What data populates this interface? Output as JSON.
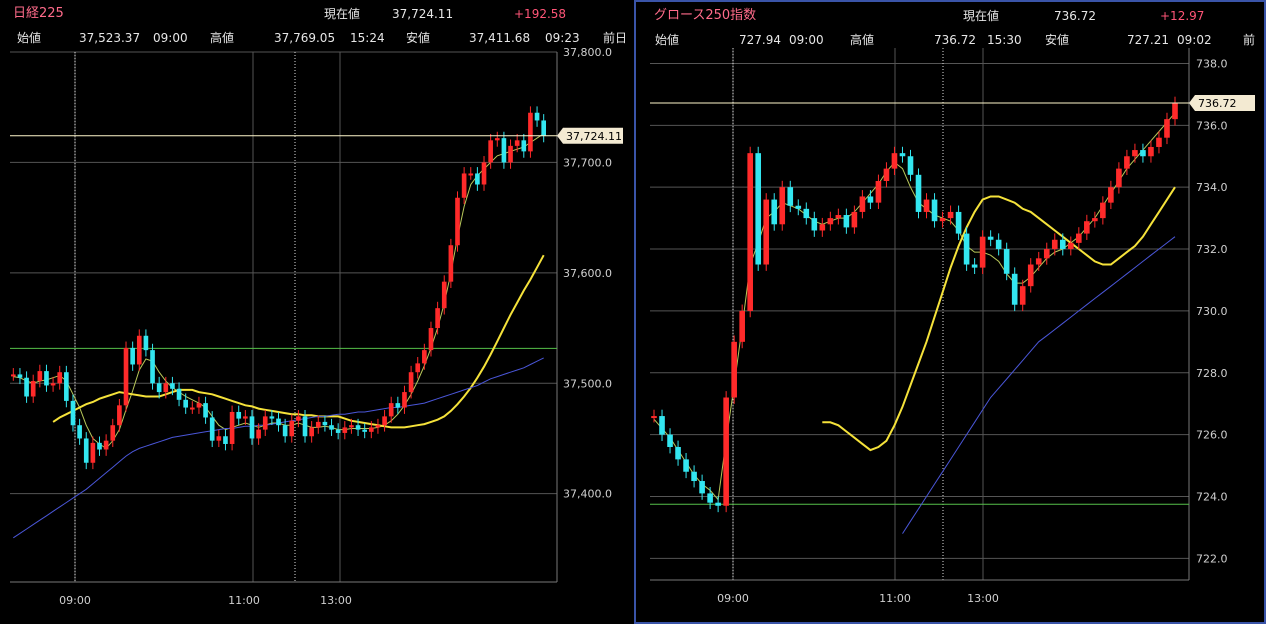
{
  "colors": {
    "up": "#ff2a2a",
    "down": "#33e6f0",
    "grid": "#555",
    "ma_short": "#b8c85a",
    "ma_mid": "#f5e23a",
    "ma_long": "#4a56d8",
    "price_line": "#fff7cc",
    "ref_line": "#56c04a"
  },
  "charts": [
    {
      "name": "日経225",
      "header": {
        "current_label": "現在値",
        "current_value": "37,724.11",
        "change": "+192.58",
        "open_label": "始値",
        "open_value": "37,523.37",
        "open_time": "09:00",
        "high_label": "高値",
        "high_value": "37,769.05",
        "high_time": "15:24",
        "low_label": "安値",
        "low_value": "37,411.68",
        "low_time": "09:23",
        "prev_label": "前日"
      },
      "price_label": "37,724.11",
      "y_ticks": [
        "37,800.0",
        "37,700.0",
        "37,600.0",
        "37,500.0",
        "37,400.0"
      ],
      "x_ticks": [
        "09:00",
        "11:00",
        "13:00"
      ]
    },
    {
      "name": "グロース250指数",
      "header": {
        "current_label": "現在値",
        "current_value": "736.72",
        "change": "+12.97",
        "open_label": "始値",
        "open_value": "727.94",
        "open_time": "09:00",
        "high_label": "高値",
        "high_value": "736.72",
        "high_time": "15:30",
        "low_label": "安値",
        "low_value": "727.21",
        "low_time": "09:02",
        "prev_label": "前"
      },
      "price_label": "736.72",
      "y_ticks": [
        "738.0",
        "736.0",
        "734.0",
        "732.0",
        "730.0",
        "728.0",
        "726.0",
        "724.0",
        "722.0"
      ],
      "x_ticks": [
        "09:00",
        "11:00",
        "13:00"
      ]
    }
  ],
  "chart_data": [
    {
      "type": "candlestick",
      "title": "日経225",
      "ylim": [
        37320,
        37800
      ],
      "y_ticks": [
        37800,
        37700,
        37600,
        37500,
        37400
      ],
      "x_ticks": [
        "09:00",
        "11:00",
        "13:00"
      ],
      "current_price": 37724.11,
      "reference_price": 37531.53,
      "series": [
        {
          "name": "close",
          "values": [
            37508,
            37505,
            37488,
            37502,
            37511,
            37498,
            37500,
            37510,
            37484,
            37462,
            37450,
            37428,
            37446,
            37440,
            37448,
            37462,
            37480,
            37532,
            37517,
            37543,
            37530,
            37500,
            37492,
            37500,
            37495,
            37485,
            37478,
            37478,
            37482,
            37469,
            37448,
            37452,
            37445,
            37474,
            37468,
            37470,
            37450,
            37458,
            37470,
            37468,
            37462,
            37452,
            37466,
            37470,
            37452,
            37460,
            37465,
            37462,
            37458,
            37455,
            37460,
            37462,
            37458,
            37456,
            37460,
            37462,
            37470,
            37482,
            37478,
            37492,
            37510,
            37518,
            37530,
            37550,
            37568,
            37592,
            37625,
            37668,
            37690,
            37690,
            37680,
            37700,
            37720,
            37722,
            37700,
            37715,
            37720,
            37710,
            37745,
            37738,
            37724
          ]
        },
        {
          "name": "MA short",
          "values": [
            37506,
            37505,
            37502,
            37500,
            37502,
            37503,
            37505,
            37507,
            37502,
            37490,
            37478,
            37462,
            37450,
            37445,
            37441,
            37448,
            37458,
            37476,
            37493,
            37512,
            37522,
            37520,
            37510,
            37502,
            37496,
            37492,
            37488,
            37485,
            37482,
            37478,
            37470,
            37462,
            37458,
            37460,
            37462,
            37464,
            37462,
            37460,
            37462,
            37464,
            37464,
            37462,
            37462,
            37464,
            37462,
            37460,
            37460,
            37461,
            37460,
            37458,
            37458,
            37459,
            37459,
            37459,
            37459,
            37460,
            37462,
            37466,
            37472,
            37480,
            37490,
            37502,
            37516,
            37532,
            37550,
            37572,
            37600,
            37632,
            37660,
            37680,
            37688,
            37694,
            37700,
            37706,
            37708,
            37710,
            37712,
            37714,
            37718,
            37722,
            37726
          ]
        },
        {
          "name": "MA mid",
          "values": [
            37465,
            37469,
            37472,
            37475,
            37478,
            37481,
            37483,
            37486,
            37488,
            37490,
            37492,
            37491,
            37490,
            37489,
            37488,
            37488,
            37488,
            37490,
            37492,
            37494,
            37494,
            37494,
            37492,
            37491,
            37490,
            37488,
            37486,
            37484,
            37482,
            37480,
            37479,
            37477,
            37476,
            37475,
            37474,
            37473,
            37472,
            37472,
            37471,
            37471,
            37470,
            37470,
            37470,
            37470,
            37468,
            37466,
            37465,
            37464,
            37463,
            37462,
            37461,
            37460,
            37460,
            37460,
            37461,
            37462,
            37463,
            37465,
            37467,
            37470,
            37475,
            37481,
            37488,
            37496,
            37505,
            37515,
            37526,
            37538,
            37550,
            37562,
            37573,
            37584,
            37594,
            37605,
            37616
          ]
        },
        {
          "name": "MA long",
          "values": [
            37360,
            37364,
            37368,
            37372,
            37376,
            37380,
            37384,
            37388,
            37392,
            37396,
            37400,
            37404,
            37409,
            37414,
            37419,
            37424,
            37429,
            37434,
            37438,
            37441,
            37443,
            37445,
            37447,
            37449,
            37451,
            37452,
            37453,
            37454,
            37455,
            37456,
            37457,
            37458,
            37459,
            37459,
            37460,
            37461,
            37461,
            37462,
            37462,
            37463,
            37464,
            37465,
            37466,
            37467,
            37468,
            37469,
            37470,
            37470,
            37471,
            37472,
            37472,
            37473,
            37474,
            37474,
            37475,
            37476,
            37477,
            37478,
            37478,
            37479,
            37480,
            37481,
            37482,
            37484,
            37486,
            37488,
            37490,
            37492,
            37494,
            37496,
            37498,
            37501,
            37504,
            37506,
            37508,
            37510,
            37512,
            37514,
            37517,
            37520,
            37523
          ]
        }
      ]
    },
    {
      "type": "candlestick",
      "title": "グロース250指数",
      "ylim": [
        721.3,
        738.5
      ],
      "y_ticks": [
        738,
        736,
        734,
        732,
        730,
        728,
        726,
        724,
        722
      ],
      "x_ticks": [
        "09:00",
        "11:00",
        "13:00"
      ],
      "current_price": 736.72,
      "reference_price": 723.75,
      "series": [
        {
          "name": "close",
          "values": [
            726.6,
            726.0,
            725.6,
            725.2,
            724.8,
            724.5,
            724.1,
            723.8,
            723.7,
            727.2,
            729.0,
            730.0,
            735.1,
            731.5,
            733.6,
            732.8,
            734.0,
            733.4,
            733.3,
            733.0,
            732.6,
            732.8,
            733.0,
            733.1,
            732.7,
            733.2,
            733.7,
            733.5,
            734.2,
            734.6,
            735.1,
            735.0,
            734.4,
            733.2,
            733.6,
            732.9,
            733.0,
            733.2,
            732.5,
            731.5,
            731.4,
            732.4,
            732.3,
            732.0,
            731.2,
            730.2,
            730.8,
            731.5,
            731.7,
            732.0,
            732.3,
            732.0,
            732.2,
            732.5,
            732.9,
            733.0,
            733.5,
            734.0,
            734.6,
            735.0,
            735.2,
            735.0,
            735.3,
            735.6,
            736.2,
            736.72
          ]
        },
        {
          "name": "MA short",
          "values": [
            726.5,
            726.2,
            725.9,
            725.5,
            725.1,
            724.7,
            724.4,
            724.2,
            723.9,
            725.8,
            727.6,
            729.5,
            731.5,
            732.2,
            733.0,
            733.2,
            733.5,
            733.4,
            733.3,
            733.1,
            732.9,
            732.8,
            732.9,
            733.0,
            733.0,
            733.2,
            733.5,
            733.8,
            734.1,
            734.5,
            734.8,
            734.6,
            734.0,
            733.5,
            733.3,
            733.1,
            733.0,
            732.9,
            732.6,
            732.1,
            731.9,
            731.9,
            731.8,
            731.6,
            731.2,
            730.9,
            730.9,
            731.1,
            731.4,
            731.7,
            731.9,
            732.0,
            732.2,
            732.4,
            732.7,
            733.0,
            733.4,
            733.8,
            734.2,
            734.6,
            734.9,
            735.2,
            735.5,
            735.8,
            736.1,
            736.4
          ]
        },
        {
          "name": "MA mid",
          "values": [
            726.4,
            726.4,
            726.3,
            726.1,
            725.9,
            725.7,
            725.5,
            725.6,
            725.8,
            726.3,
            726.9,
            727.6,
            728.3,
            729.0,
            729.8,
            730.6,
            731.4,
            732.1,
            732.7,
            733.2,
            733.6,
            733.7,
            733.7,
            733.6,
            733.5,
            733.3,
            733.2,
            733.0,
            732.8,
            732.6,
            732.4,
            732.2,
            732.0,
            731.8,
            731.6,
            731.5,
            731.5,
            731.7,
            731.9,
            732.1,
            732.4,
            732.8,
            733.2,
            733.6,
            734.0
          ]
        },
        {
          "name": "MA long",
          "values": [
            722.8,
            723.2,
            723.6,
            724.0,
            724.4,
            724.8,
            725.2,
            725.6,
            726.0,
            726.4,
            726.8,
            727.2,
            727.5,
            727.8,
            728.1,
            728.4,
            728.7,
            729.0,
            729.2,
            729.4,
            729.6,
            729.8,
            730.0,
            730.2,
            730.4,
            730.6,
            730.8,
            731.0,
            731.2,
            731.4,
            731.6,
            731.8,
            732.0,
            732.2,
            732.4
          ]
        }
      ]
    }
  ]
}
